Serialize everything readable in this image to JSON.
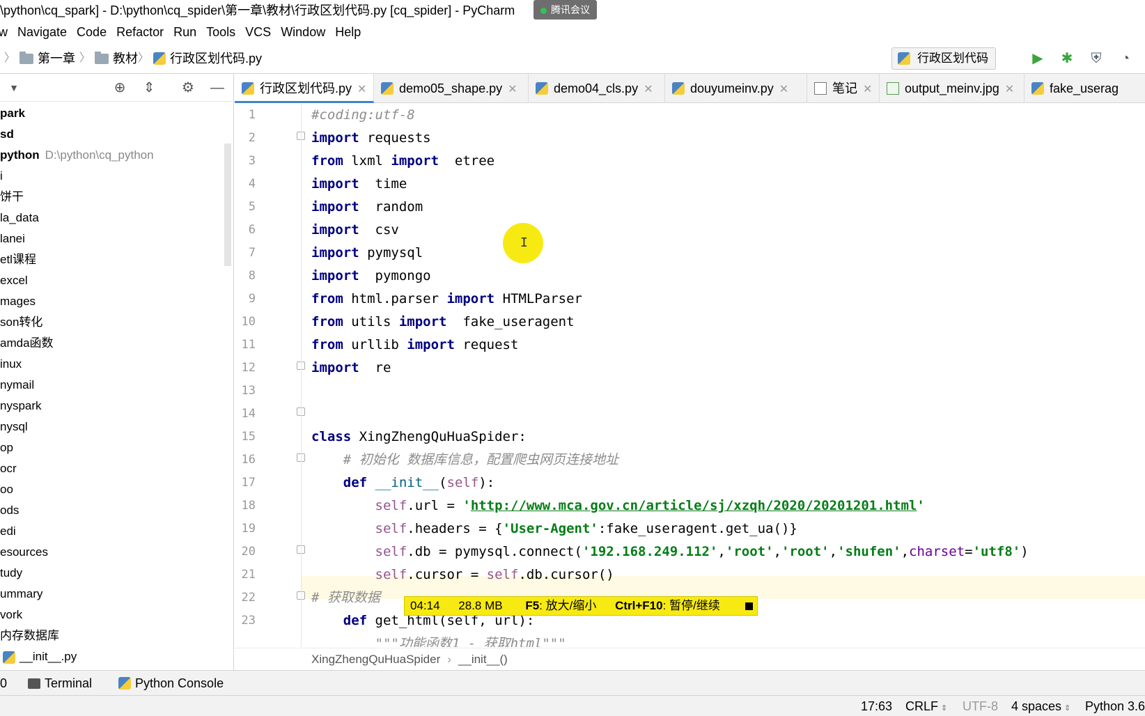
{
  "window": {
    "title": "\\python\\cq_spark] - D:\\python\\cq_spider\\第一章\\教材\\行政区划代码.py [cq_spider] - PyCharm",
    "meeting_badge": "腾讯会议"
  },
  "menu": [
    "w",
    "Navigate",
    "Code",
    "Refactor",
    "Run",
    "Tools",
    "VCS",
    "Window",
    "Help"
  ],
  "navbar": {
    "crumbs": [
      "第一章",
      "教材",
      "行政区划代码.py"
    ],
    "run_config": "行政区划代码"
  },
  "project": {
    "tree": [
      {
        "label": "park",
        "bold": true
      },
      {
        "label": "sd",
        "bold": true
      },
      {
        "label": "python",
        "bold": true,
        "path": "D:\\python\\cq_python"
      },
      {
        "label": "i"
      },
      {
        "label": "饼干"
      },
      {
        "label": "la_data"
      },
      {
        "label": "lanei"
      },
      {
        "label": "etl课程"
      },
      {
        "label": "excel"
      },
      {
        "label": "mages"
      },
      {
        "label": "son转化"
      },
      {
        "label": "amda函数"
      },
      {
        "label": "inux"
      },
      {
        "label": "nymail"
      },
      {
        "label": "nyspark"
      },
      {
        "label": "nysql"
      },
      {
        "label": "op"
      },
      {
        "label": "ocr"
      },
      {
        "label": "oo"
      },
      {
        "label": "ods"
      },
      {
        "label": "edi"
      },
      {
        "label": "esources"
      },
      {
        "label": "tudy"
      },
      {
        "label": "ummary"
      },
      {
        "label": "vork"
      },
      {
        "label": "内存数据库"
      },
      {
        "label": "__init__.py"
      }
    ]
  },
  "tabs": [
    {
      "label": "行政区划代码.py",
      "icon": "python-file-icon",
      "active": true
    },
    {
      "label": "demo05_shape.py",
      "icon": "python-file-icon"
    },
    {
      "label": "demo04_cls.py",
      "icon": "python-file-icon"
    },
    {
      "label": "douyumeinv.py",
      "icon": "python-file-icon"
    },
    {
      "label": "笔记",
      "icon": "text-file-icon"
    },
    {
      "label": "output_meinv.jpg",
      "icon": "image-file-icon"
    },
    {
      "label": "fake_userag",
      "icon": "python-file-icon"
    }
  ],
  "editor": {
    "line_numbers": [
      "1",
      "2",
      "3",
      "4",
      "5",
      "6",
      "7",
      "8",
      "9",
      "10",
      "11",
      "12",
      "13",
      "14",
      "15",
      "16",
      "17",
      "18",
      "19",
      "20",
      "21",
      "22",
      "23"
    ],
    "current_line": "17",
    "lines": {
      "l1": "#coding:utf-8",
      "l2_kw": "import",
      "l2_rest": " requests",
      "l3_kw1": "from",
      "l3_mid": " lxml ",
      "l3_kw2": "import",
      "l3_rest": "  etree",
      "l4_kw": "import",
      "l4_rest": "  time",
      "l5_kw": "import",
      "l5_rest": "  random",
      "l6_kw": "import",
      "l6_rest": "  csv",
      "l7_kw": "import",
      "l7_rest": " pymysql",
      "l8_kw": "import",
      "l8_rest": "  pymongo",
      "l9_kw1": "from",
      "l9_mid": " html.parser ",
      "l9_kw2": "import",
      "l9_rest": " HTMLParser",
      "l10_kw1": "from",
      "l10_mid": " utils ",
      "l10_kw2": "import",
      "l10_rest": "  fake_useragent",
      "l11_kw1": "from",
      "l11_mid": " urllib ",
      "l11_kw2": "import",
      "l11_rest": " request",
      "l12_kw": "import",
      "l12_rest": "  re",
      "l14_kw": "class",
      "l14_rest": " XingZhengQuHuaSpider:",
      "l15": "    # 初始化 数据库信息，配置爬虫网页连接地址",
      "l16_ind": "    ",
      "l16_kw": "def",
      "l16_sp": " ",
      "l16_fn": "__init__",
      "l16_p1": "(",
      "l16_self": "self",
      "l16_p2": "):",
      "l17_ind": "        ",
      "l17_self": "self",
      "l17_mid": ".url = ",
      "l17_q1": "'",
      "l17_url": "http://www.mca.gov.cn/article/sj/xzqh/2020/20201201.html",
      "l17_q2": "'",
      "l18_ind": "        ",
      "l18_self": "self",
      "l18_mid": ".headers = {",
      "l18_str": "'User-Agent'",
      "l18_rest": ":fake_useragent.get_ua()}",
      "l19_ind": "        ",
      "l19_self": "self",
      "l19_mid": ".db = pymysql.connect(",
      "l19_s1": "'192.168.249.112'",
      "l19_c1": ",",
      "l19_s2": "'root'",
      "l19_c2": ",",
      "l19_s3": "'root'",
      "l19_c3": ",",
      "l19_s4": "'shufen'",
      "l19_c4": ",",
      "l19_pm": "charset",
      "l19_eq": "=",
      "l19_s5": "'utf8'",
      "l19_end": ")",
      "l20_ind": "        ",
      "l20_self1": "self",
      "l20_mid": ".cursor = ",
      "l20_self2": "self",
      "l20_rest": ".db.cursor()",
      "l21": "# 获取数据",
      "l22_ind": "    ",
      "l22_kw": "def",
      "l22_rest": " get_html(self, url):",
      "l23": "        \"\"\"功能函数1 - 获取html\"\"\""
    }
  },
  "editor_breadcrumb": [
    "XingZhengQuHuaSpider",
    "__init__()"
  ],
  "recording": {
    "time": "04:14",
    "size": "28.8 MB",
    "key1": "F5",
    "action1": ": 放大/缩小",
    "key2": "Ctrl+F10",
    "action2": ": 暂停/继续"
  },
  "toolwindows": {
    "terminal": "Terminal",
    "python_console": "Python Console",
    "left_stub": "0"
  },
  "status": {
    "position": "17:63",
    "line_sep": "CRLF",
    "encoding": "UTF-8",
    "indent": "4 spaces",
    "interpreter": "Python 3.6"
  }
}
